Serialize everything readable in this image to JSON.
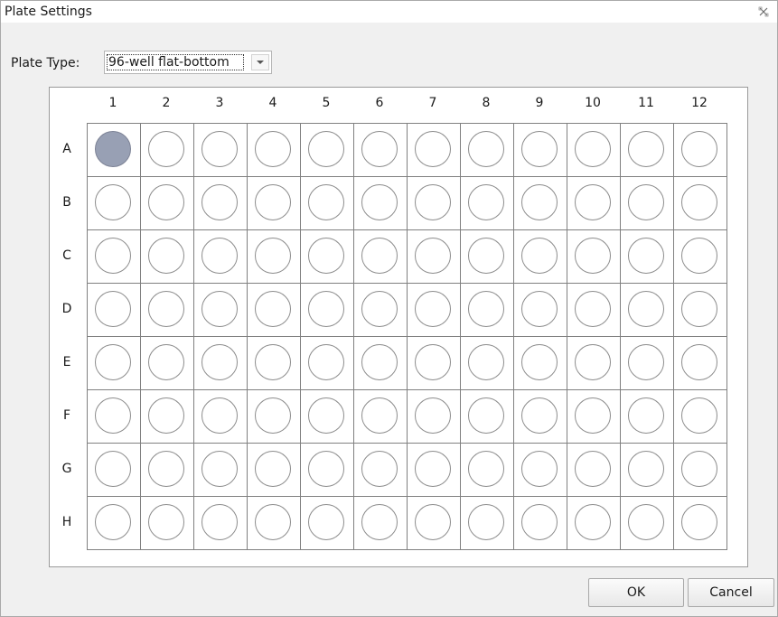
{
  "dialog": {
    "title": "Plate Settings",
    "close_icon": "close-icon"
  },
  "plate_type": {
    "label": "Plate Type:",
    "value": "96-well flat-bottom",
    "dropdown_icon": "chevron-down-icon"
  },
  "plate": {
    "columns": [
      "1",
      "2",
      "3",
      "4",
      "5",
      "6",
      "7",
      "8",
      "9",
      "10",
      "11",
      "12"
    ],
    "rows": [
      "A",
      "B",
      "C",
      "D",
      "E",
      "F",
      "G",
      "H"
    ],
    "selected_wells": [
      "A1"
    ],
    "selected_color": "#98a0b4"
  },
  "buttons": {
    "ok": "OK",
    "cancel": "Cancel"
  }
}
